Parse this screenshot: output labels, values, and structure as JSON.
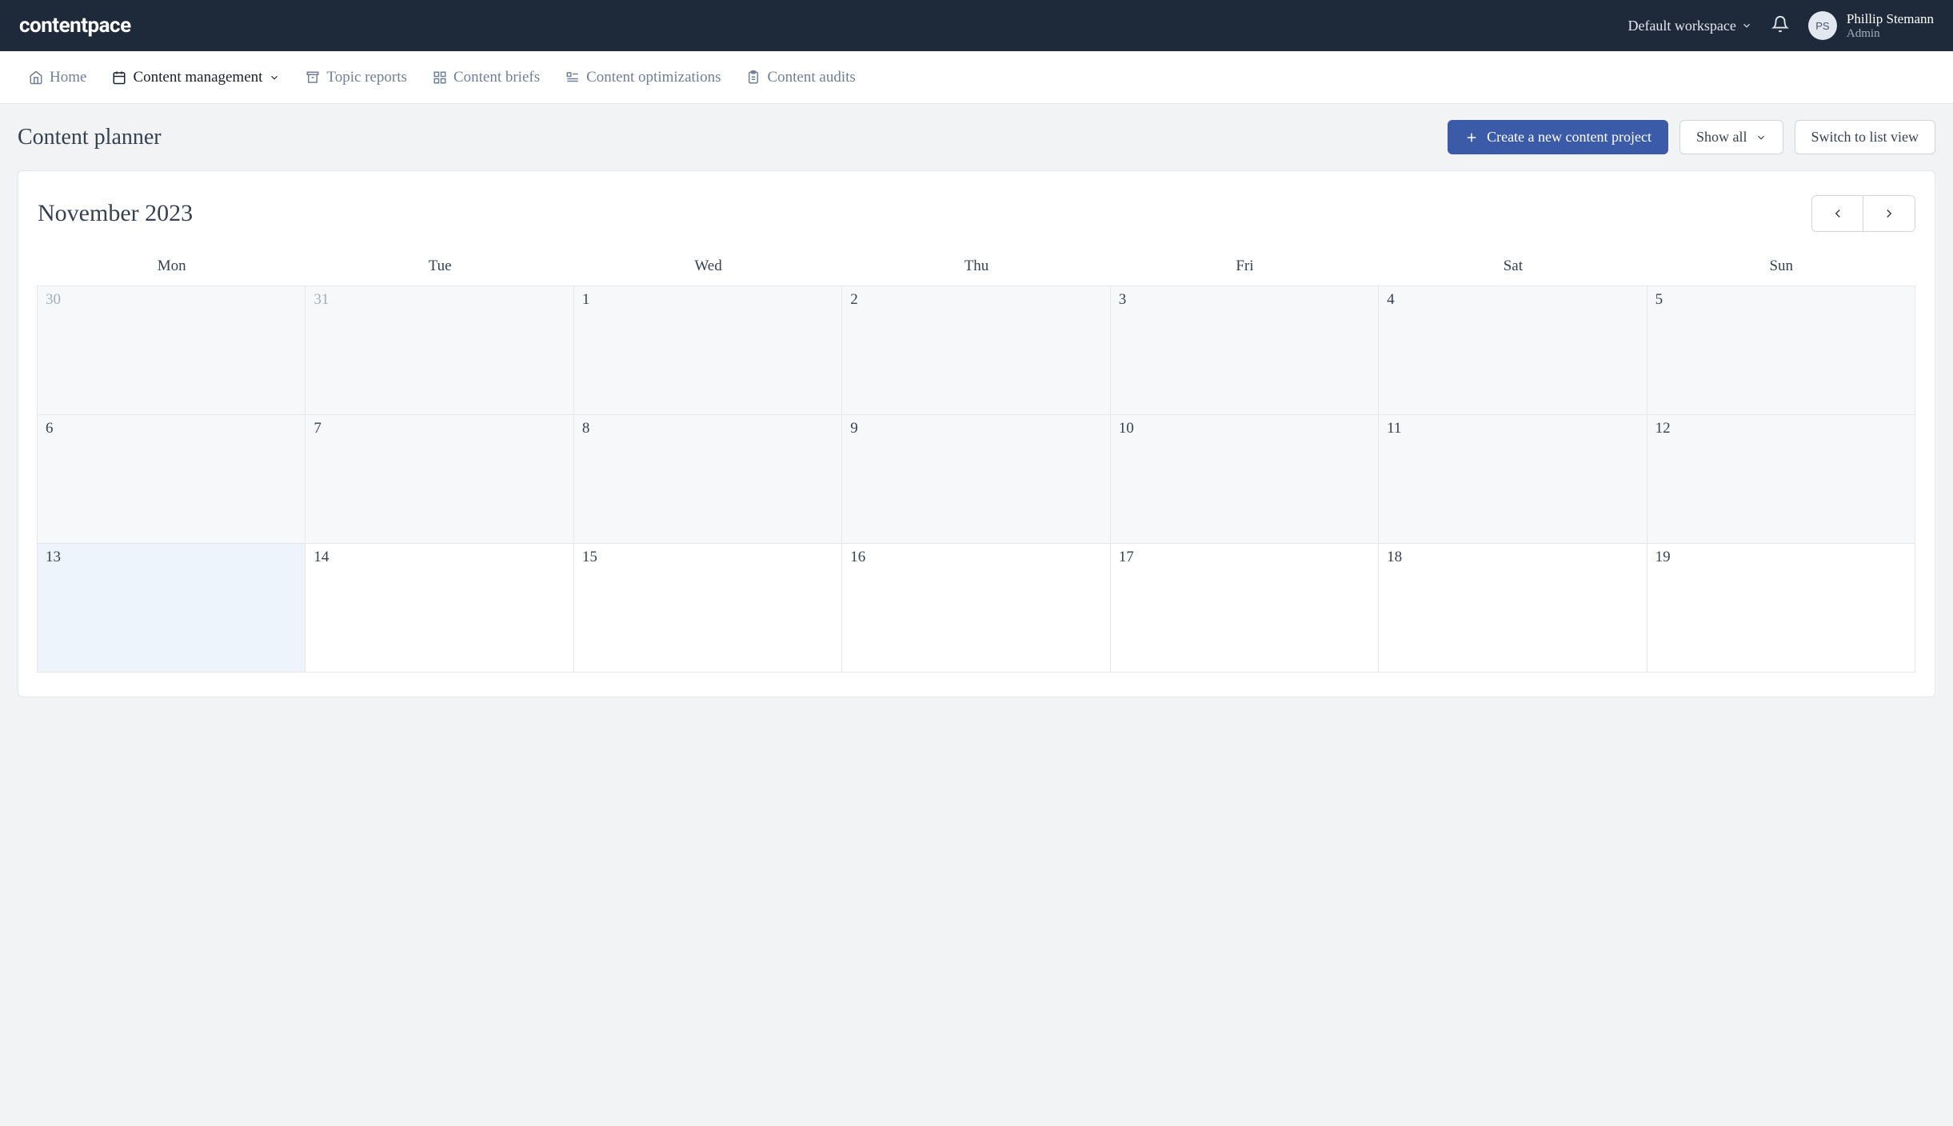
{
  "brand": "contentpace",
  "header": {
    "workspace_label": "Default workspace",
    "user": {
      "initials": "PS",
      "name": "Phillip Stemann",
      "role": "Admin"
    }
  },
  "nav": {
    "home": "Home",
    "content_management": "Content management",
    "topic_reports": "Topic reports",
    "content_briefs": "Content briefs",
    "content_optimizations": "Content optimizations",
    "content_audits": "Content audits"
  },
  "page": {
    "title": "Content planner",
    "create_button": "Create a new content project",
    "show_all": "Show all",
    "switch_view": "Switch to list view"
  },
  "calendar": {
    "month_label": "November 2023",
    "day_headers": [
      "Mon",
      "Tue",
      "Wed",
      "Thu",
      "Fri",
      "Sat",
      "Sun"
    ],
    "days": [
      {
        "n": "30",
        "muted": true,
        "week": "past"
      },
      {
        "n": "31",
        "muted": true,
        "week": "past"
      },
      {
        "n": "1",
        "week": "past"
      },
      {
        "n": "2",
        "week": "past"
      },
      {
        "n": "3",
        "week": "past"
      },
      {
        "n": "4",
        "week": "past"
      },
      {
        "n": "5",
        "week": "past"
      },
      {
        "n": "6",
        "week": "past"
      },
      {
        "n": "7",
        "week": "past"
      },
      {
        "n": "8",
        "week": "past"
      },
      {
        "n": "9",
        "week": "past"
      },
      {
        "n": "10",
        "week": "past"
      },
      {
        "n": "11",
        "week": "past"
      },
      {
        "n": "12",
        "week": "past"
      },
      {
        "n": "13",
        "week": "current",
        "today": true
      },
      {
        "n": "14",
        "week": "current"
      },
      {
        "n": "15",
        "week": "current"
      },
      {
        "n": "16",
        "week": "current"
      },
      {
        "n": "17",
        "week": "current"
      },
      {
        "n": "18",
        "week": "current"
      },
      {
        "n": "19",
        "week": "current"
      }
    ]
  }
}
